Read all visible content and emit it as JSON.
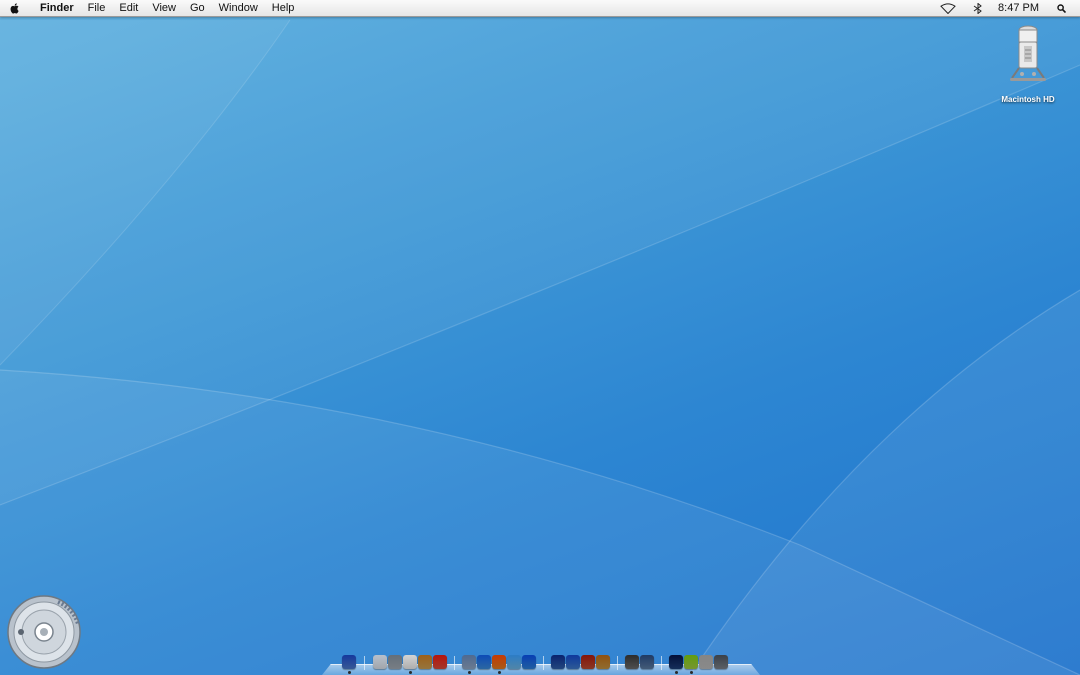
{
  "menubar": {
    "apple_icon": "apple-icon",
    "app_name": "Finder",
    "menus": [
      "File",
      "Edit",
      "View",
      "Go",
      "Window",
      "Help"
    ],
    "extras": [
      "airport-wifi-icon",
      "bluetooth-icon"
    ],
    "clock": "8:47 PM",
    "spotlight_icon": "spotlight-search-icon"
  },
  "desktop": {
    "icons": [
      {
        "label": "Macintosh HD",
        "icon": "hard-drive-icon"
      }
    ]
  },
  "dock": {
    "apps": [
      {
        "icon": "finder-icon",
        "color": "#4a78c8",
        "running": true
      },
      {
        "icon": "mail-icon",
        "color": "#d8dde4",
        "running": false
      },
      {
        "icon": "ichat-icon",
        "color": "#a0a8b0",
        "running": false
      },
      {
        "icon": "textedit-icon",
        "color": "#e8e8e8",
        "running": true
      },
      {
        "icon": "address-book-icon",
        "color": "#c89c52",
        "running": false
      },
      {
        "icon": "ical-icon",
        "color": "#d84a3a",
        "running": false
      },
      {
        "icon": "system-preferences-icon",
        "color": "#8ea4c0",
        "running": true
      },
      {
        "icon": "safari-icon",
        "color": "#3a8ad8",
        "running": false
      },
      {
        "icon": "firefox-icon",
        "color": "#e07a20",
        "running": true
      },
      {
        "icon": "preview-icon",
        "color": "#6bb2e0",
        "running": false
      },
      {
        "icon": "internet-explorer-icon",
        "color": "#2c7ed6",
        "running": false
      },
      {
        "icon": "imovie-icon",
        "color": "#2f5ea8",
        "running": false
      },
      {
        "icon": "iphoto-icon",
        "color": "#3c78c8",
        "running": false
      },
      {
        "icon": "idvd-icon",
        "color": "#b84a30",
        "running": false
      },
      {
        "icon": "garageband-icon",
        "color": "#c09040",
        "running": false
      },
      {
        "icon": "utility-icon",
        "color": "#6a6a6a",
        "running": false
      },
      {
        "icon": "remote-desktop-icon",
        "color": "#5a7aa0",
        "running": false
      },
      {
        "icon": "photoshop-icon",
        "color": "#1c3e78",
        "running": true
      },
      {
        "icon": "script-editor-icon",
        "color": "#9ec840",
        "running": true
      },
      {
        "icon": "dvd-player-icon",
        "color": "#b8b8b8",
        "running": false
      },
      {
        "icon": "trash-icon",
        "color": "#7a8088",
        "running": false
      }
    ]
  },
  "widgets": {
    "corner_disc": "disc-burner-icon"
  }
}
